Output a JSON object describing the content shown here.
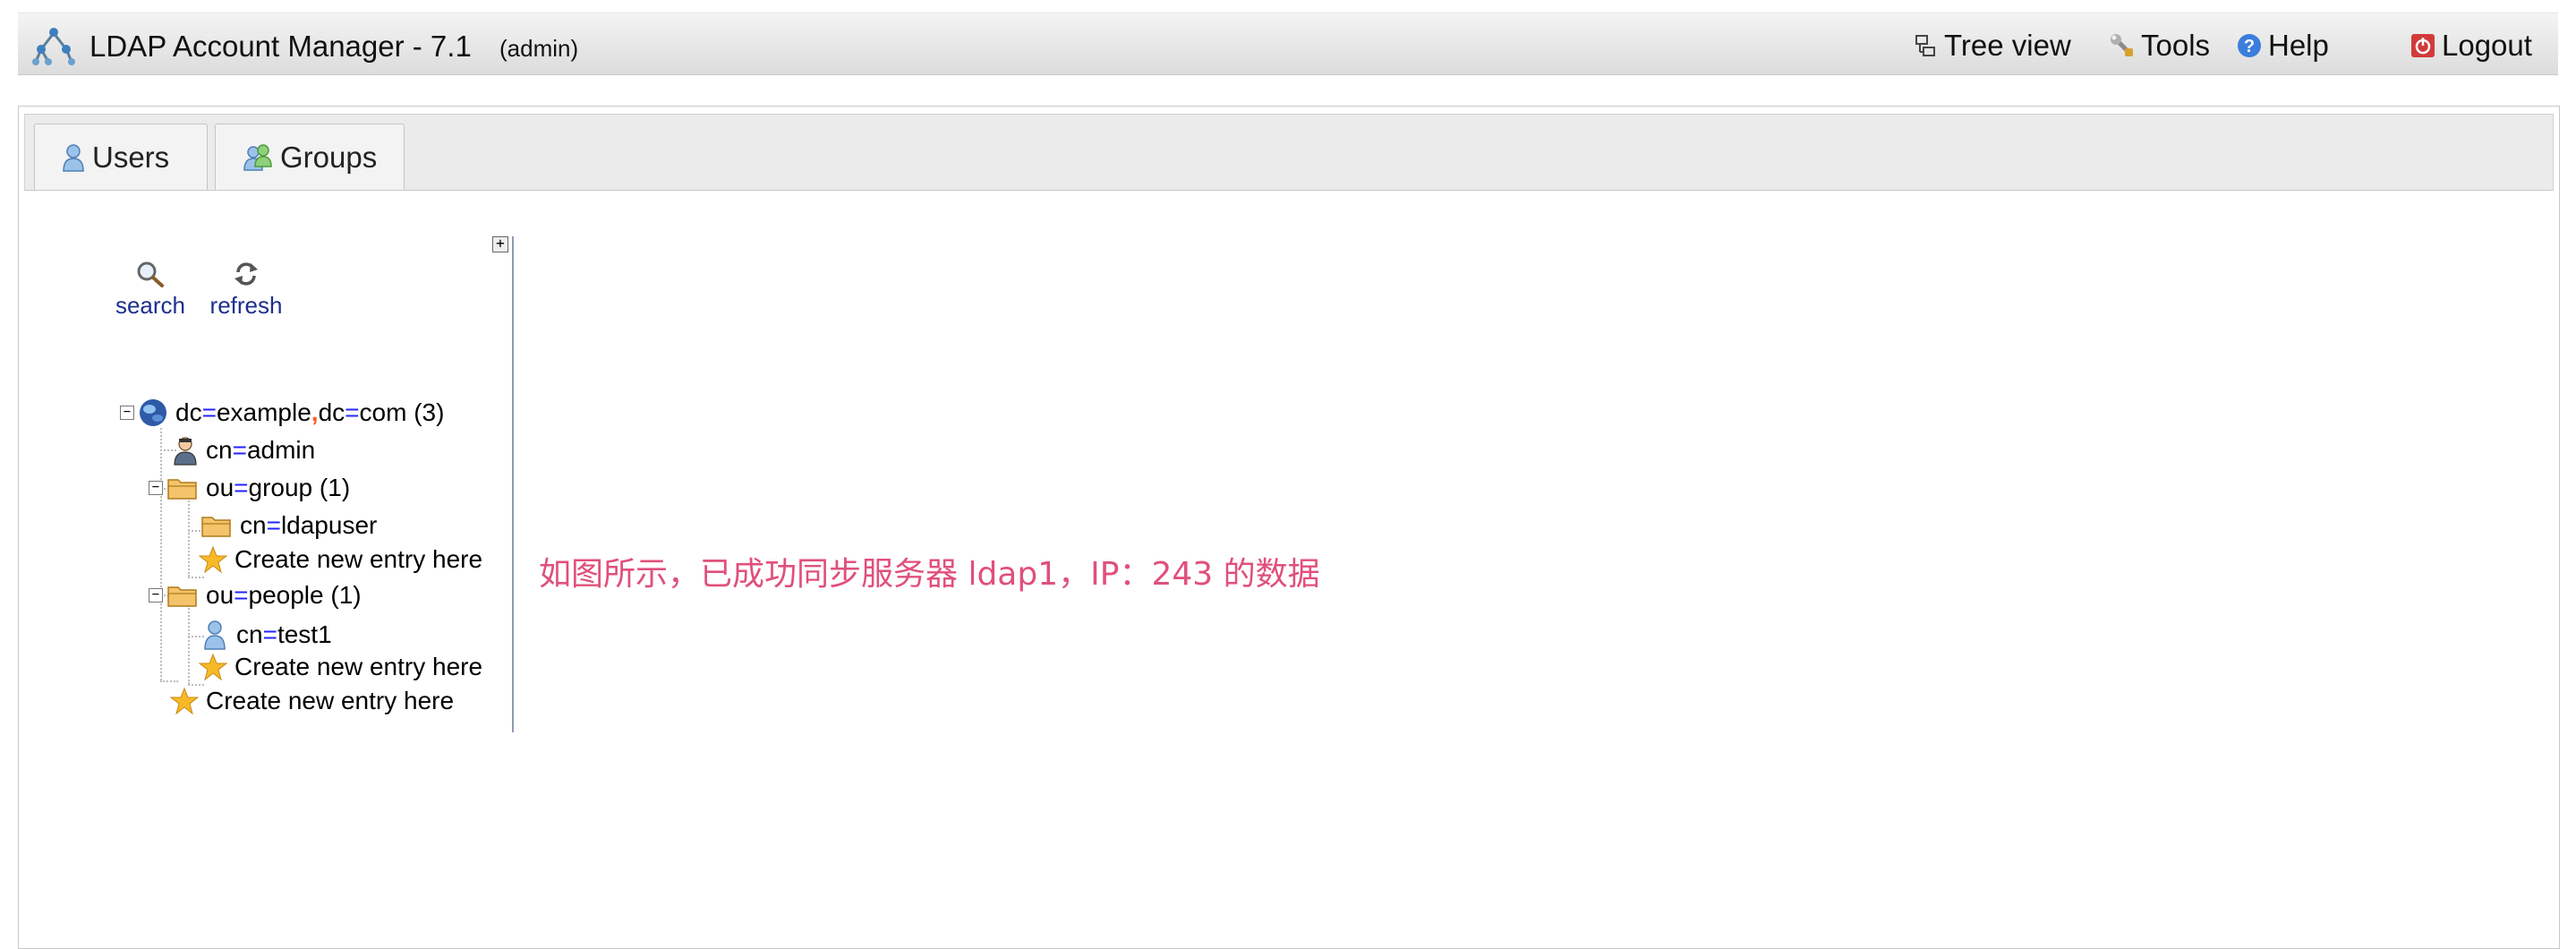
{
  "header": {
    "title": "LDAP Account Manager - 7.1",
    "user": "(admin)",
    "links": {
      "tree_view": "Tree view",
      "tools": "Tools",
      "help": "Help",
      "logout": "Logout"
    }
  },
  "tabs": {
    "users": "Users",
    "groups": "Groups"
  },
  "tree_tools": {
    "search": "search",
    "refresh": "refresh"
  },
  "tree": {
    "root": {
      "rdn1_attr": "dc",
      "rdn1_val": "example",
      "rdn2_attr": "dc",
      "rdn2_val": "com",
      "count": "(3)"
    },
    "admin": {
      "attr": "cn",
      "val": "admin"
    },
    "group_ou": {
      "attr": "ou",
      "val": "group",
      "count": "(1)"
    },
    "ldapuser": {
      "attr": "cn",
      "val": "ldapuser"
    },
    "group_create": "Create new entry here",
    "people_ou": {
      "attr": "ou",
      "val": "people",
      "count": "(1)"
    },
    "test1": {
      "attr": "cn",
      "val": "test1"
    },
    "people_create": "Create new entry here",
    "root_create": "Create new entry here"
  },
  "annotation": "如图所示，已成功同步服务器 ldap1，IP：243 的数据",
  "icons": {
    "app_logo": "network-tree-icon",
    "tree_view": "tree-view-icon",
    "tools": "wrench-icon",
    "help": "help-icon",
    "logout": "logout-icon",
    "users_tab": "user-icon",
    "groups_tab": "group-icon",
    "search": "magnifier-icon",
    "refresh": "refresh-icon",
    "root": "globe-icon",
    "admin": "admin-user-icon",
    "ou": "folder-icon",
    "new_entry": "star-icon"
  },
  "colors": {
    "link_blue": "#1d2f8c",
    "equals_blue": "#2323ff",
    "comma_orange": "#ff5a1e",
    "annotation_pink": "#e0507a",
    "tree_divider": "#8f9bb3"
  }
}
